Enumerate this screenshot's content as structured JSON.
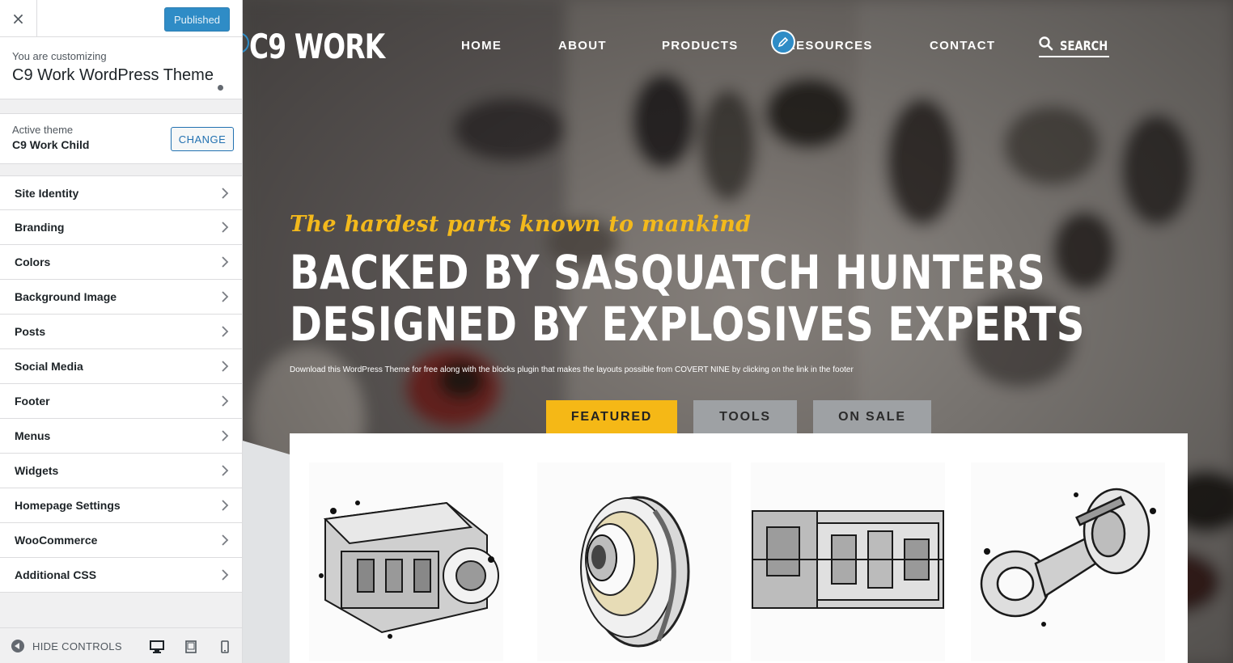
{
  "customizer": {
    "close_label": "×",
    "published_label": "Published",
    "info": {
      "customizing_label": "You are customizing",
      "site_title": "C9 Work WordPress Theme"
    },
    "theme": {
      "active_label": "Active theme",
      "name": "C9 Work Child",
      "change_label": "CHANGE"
    },
    "sections": [
      {
        "label": "Site Identity"
      },
      {
        "label": "Branding"
      },
      {
        "label": "Colors"
      },
      {
        "label": "Background Image"
      },
      {
        "label": "Posts"
      },
      {
        "label": "Social Media"
      },
      {
        "label": "Footer"
      },
      {
        "label": "Menus"
      },
      {
        "label": "Widgets"
      },
      {
        "label": "Homepage Settings"
      },
      {
        "label": "WooCommerce"
      },
      {
        "label": "Additional CSS"
      }
    ],
    "footer": {
      "hide_controls_label": "HIDE CONTROLS",
      "devices": [
        "desktop-icon",
        "tablet-icon",
        "mobile-icon"
      ]
    }
  },
  "site": {
    "logo": "C9 WORK",
    "nav": [
      "HOME",
      "ABOUT",
      "PRODUCTS",
      "RESOURCES",
      "CONTACT"
    ],
    "search_label": "SEARCH",
    "hero": {
      "tagline": "The hardest parts known to mankind",
      "headline_1": "BACKED BY SASQUATCH HUNTERS",
      "headline_2": "DESIGNED BY EXPLOSIVES EXPERTS",
      "subtext": "Download this WordPress Theme for free along with the blocks plugin that makes the layouts possible from COVERT NINE by clicking on the link in the footer"
    },
    "tabs": [
      "FEATURED",
      "TOOLS",
      "ON SALE"
    ],
    "products": [
      {
        "icon": "engine-image"
      },
      {
        "icon": "clutch-image"
      },
      {
        "icon": "transmission-image"
      },
      {
        "icon": "piston-image"
      }
    ]
  },
  "colors": {
    "accent_blue": "#2f8cc6",
    "tagline_yellow": "#f3b91c",
    "tab_active": "#f5b816",
    "tab_inactive": "#9ea1a4"
  }
}
